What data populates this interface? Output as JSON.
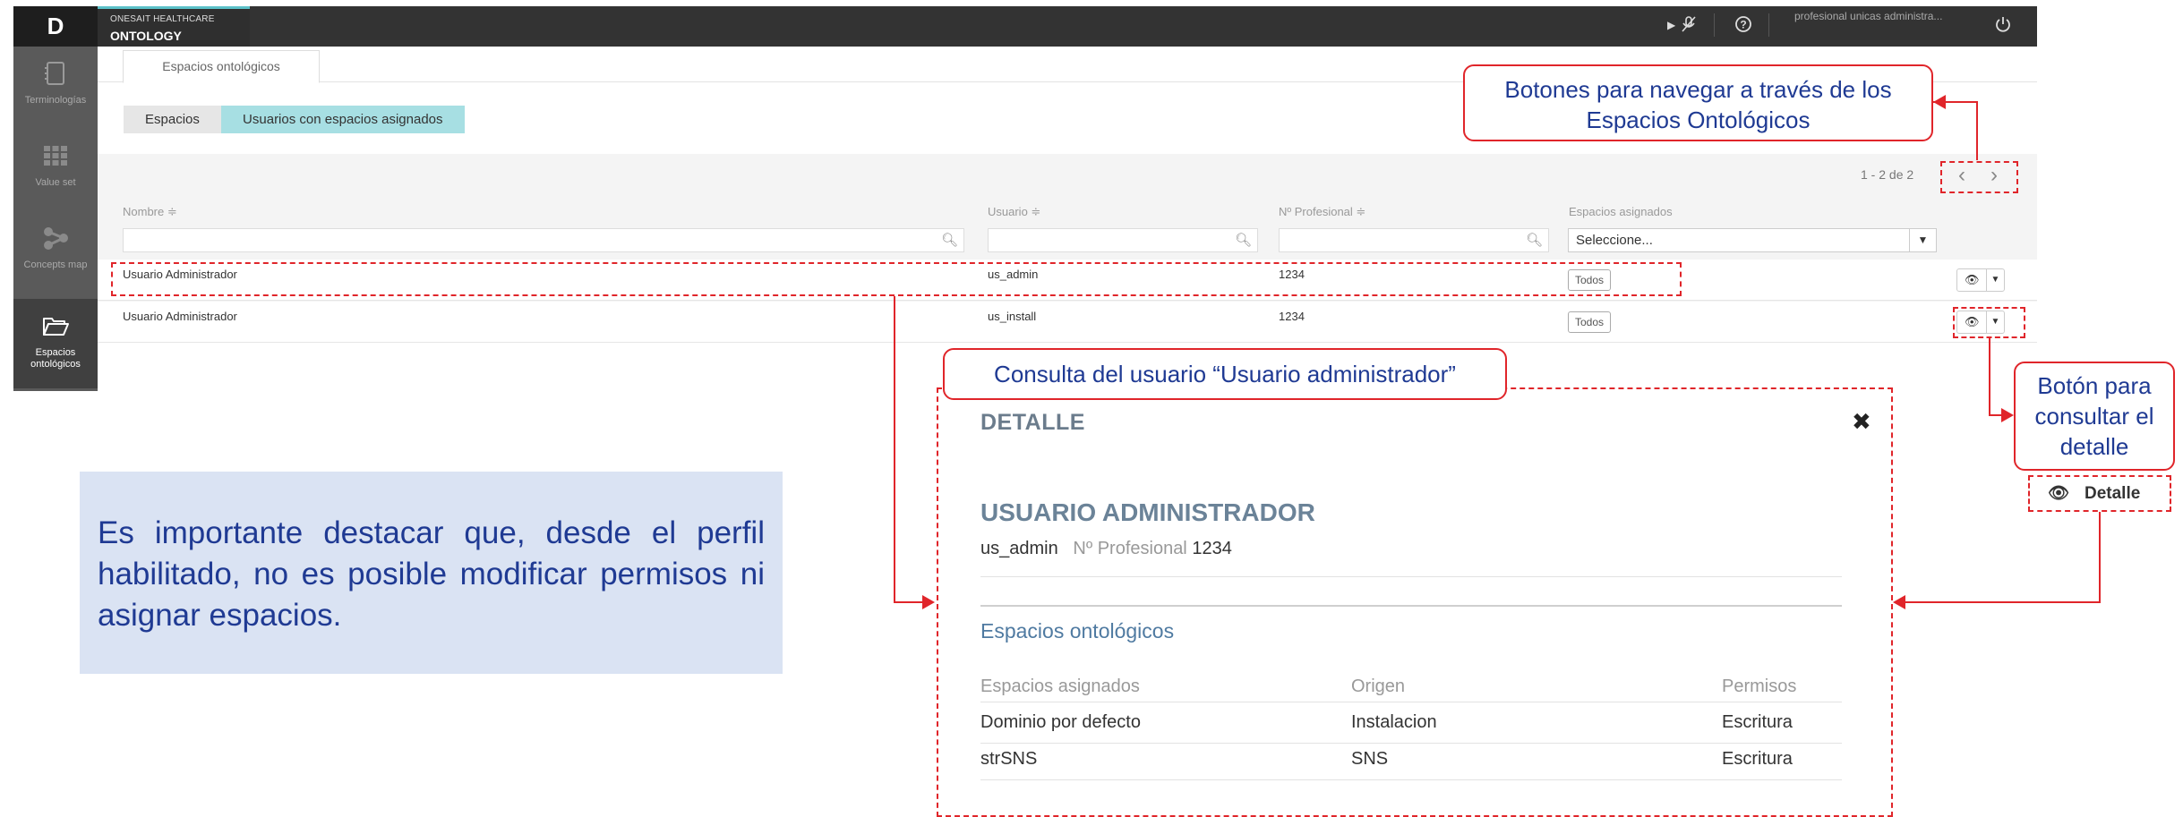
{
  "app": {
    "logo": "D",
    "brand_sub": "ONESAIT HEALTHCARE",
    "brand_main": "ONTOLOGY",
    "user_label": "profesional unicas administra..."
  },
  "sidebar": {
    "items": [
      {
        "label": "Terminologías",
        "icon": "book-icon"
      },
      {
        "label": "Value set",
        "icon": "grid-icon"
      },
      {
        "label": "Concepts map",
        "icon": "share-nodes-icon"
      },
      {
        "label": "Espacios ontológicos",
        "icon": "folder-open-icon",
        "active": true
      }
    ]
  },
  "tabs": {
    "main": "Espacios ontológicos"
  },
  "segments": {
    "spaces": "Espacios",
    "users": "Usuarios con espacios asignados"
  },
  "pagination": {
    "text": "1 - 2 de 2"
  },
  "table": {
    "headers": [
      "Nombre ≑",
      "Usuario ≑",
      "Nº Profesional ≑",
      "Espacios asignados"
    ],
    "select_placeholder": "Seleccione...",
    "rows": [
      {
        "name": "Usuario Administrador",
        "user": "us_admin",
        "prof": "1234",
        "spaces": "Todos"
      },
      {
        "name": "Usuario Administrador",
        "user": "us_install",
        "prof": "1234",
        "spaces": "Todos"
      }
    ]
  },
  "annotations": {
    "nav_callout": "Botones para navegar a través de los Espacios Ontológicos",
    "detail_callout": "Botón para consultar el detalle",
    "query_callout": "Consulta del usuario “Usuario administrador”",
    "detail_button": "Detalle",
    "note": "Es importante destacar que, desde el perfil habilitado, no es posible modificar permisos ni asignar espacios."
  },
  "detail": {
    "title": "DETALLE",
    "close": "✖",
    "user_title": "USUARIO ADMINISTRADOR",
    "username": "us_admin",
    "prof_label": "Nº Profesional",
    "prof_value": "1234",
    "spaces_title": "Espacios ontológicos",
    "headers": [
      "Espacios asignados",
      "Origen",
      "Permisos"
    ],
    "rows": [
      {
        "space": "Dominio por defecto",
        "origin": "Instalacion",
        "perm": "Escritura"
      },
      {
        "space": "strSNS",
        "origin": "SNS",
        "perm": "Escritura"
      }
    ]
  },
  "colors": {
    "accent": "#a7dfe3",
    "annotation_red": "#e0252a",
    "annotation_text": "#1f3a93",
    "topbar": "#333333",
    "sidebar": "#5a5a5a"
  }
}
